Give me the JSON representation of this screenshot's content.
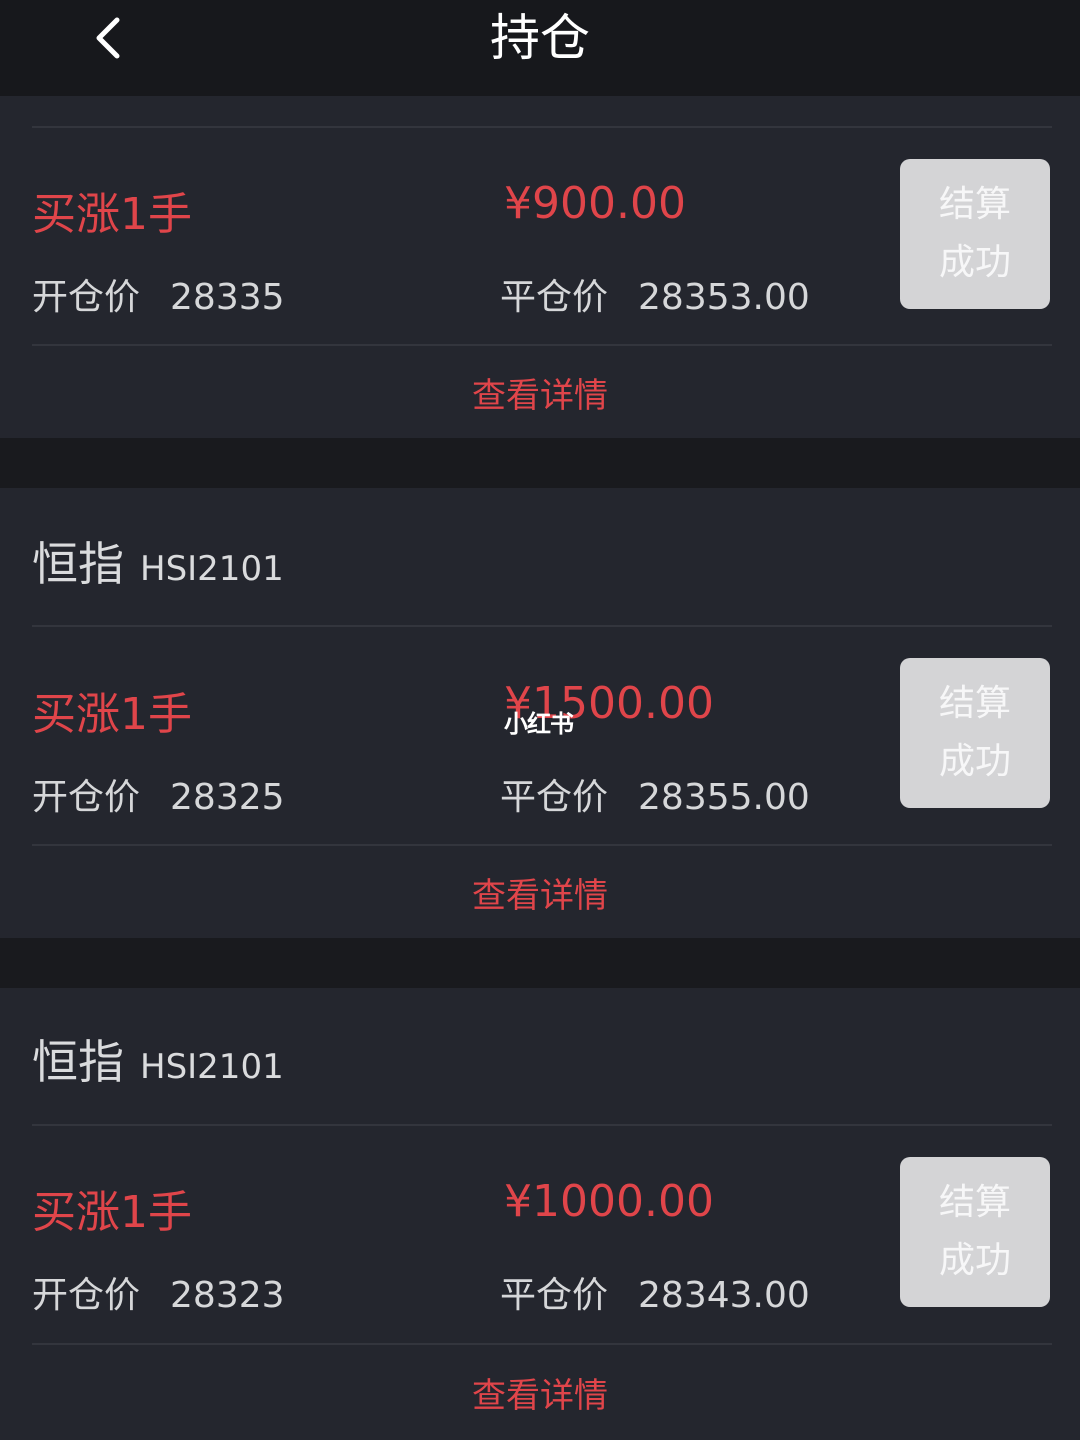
{
  "header": {
    "title": "持仓",
    "back_icon": "chevron-left-icon"
  },
  "positions": [
    {
      "product_name": "",
      "product_code": "",
      "direction": "买涨1手",
      "profit": "¥900.00",
      "open_label": "开仓价",
      "open_price": "28335",
      "close_label": "平仓价",
      "close_price": "28353.00",
      "status_line1": "结算",
      "status_line2": "成功",
      "detail_label": "查看详情"
    },
    {
      "product_name": "恒指",
      "product_code": "HSI2101",
      "direction": "买涨1手",
      "profit": "¥1500.00",
      "open_label": "开仓价",
      "open_price": "28325",
      "close_label": "平仓价",
      "close_price": "28355.00",
      "status_line1": "结算",
      "status_line2": "成功",
      "detail_label": "查看详情"
    },
    {
      "product_name": "恒指",
      "product_code": "HSI2101",
      "direction": "买涨1手",
      "profit": "¥1000.00",
      "open_label": "开仓价",
      "open_price": "28323",
      "close_label": "平仓价",
      "close_price": "28343.00",
      "status_line1": "结算",
      "status_line2": "成功",
      "detail_label": "查看详情"
    }
  ],
  "watermark": "小红书",
  "colors": {
    "accent_red": "#e0454a",
    "background": "#1b1d22",
    "card": "#24262e",
    "status_button": "#d4d4d6"
  }
}
